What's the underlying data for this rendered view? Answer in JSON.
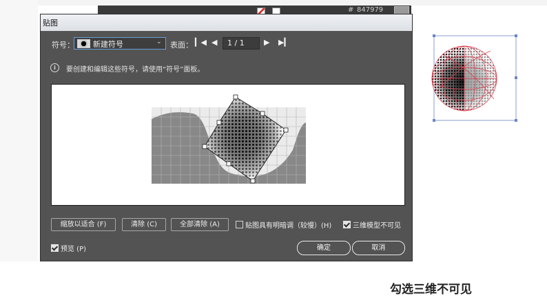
{
  "background": {
    "hex_label": "#",
    "hex_value": "847979"
  },
  "dialog": {
    "title": "贴图",
    "symbol": {
      "label": "符号：",
      "selected": "新建符号"
    },
    "surface": {
      "label": "表面：",
      "page": "1 / 1"
    },
    "info_text": "要创建和编辑这些符号，请使用“符号”面板。",
    "buttons": {
      "fit": "缩放以适合 (F)",
      "clear": "清除 (C)",
      "clear_all": "全部清除 (A)",
      "ok": "确定",
      "cancel": "取消"
    },
    "checkboxes": {
      "shading": {
        "label": "贴图具有明暗调（较慢）(H)",
        "checked": false
      },
      "invisible": {
        "label": "三维模型不可见",
        "checked": true
      },
      "preview": {
        "label": "预览 (P)",
        "checked": true
      }
    }
  },
  "caption": "勾选三维不可见",
  "colors": {
    "dialog_bg": "#535353",
    "accent_blue": "#6aa0d8",
    "selection_red": "#e03a4a",
    "bbox_blue": "#6b86c6"
  }
}
